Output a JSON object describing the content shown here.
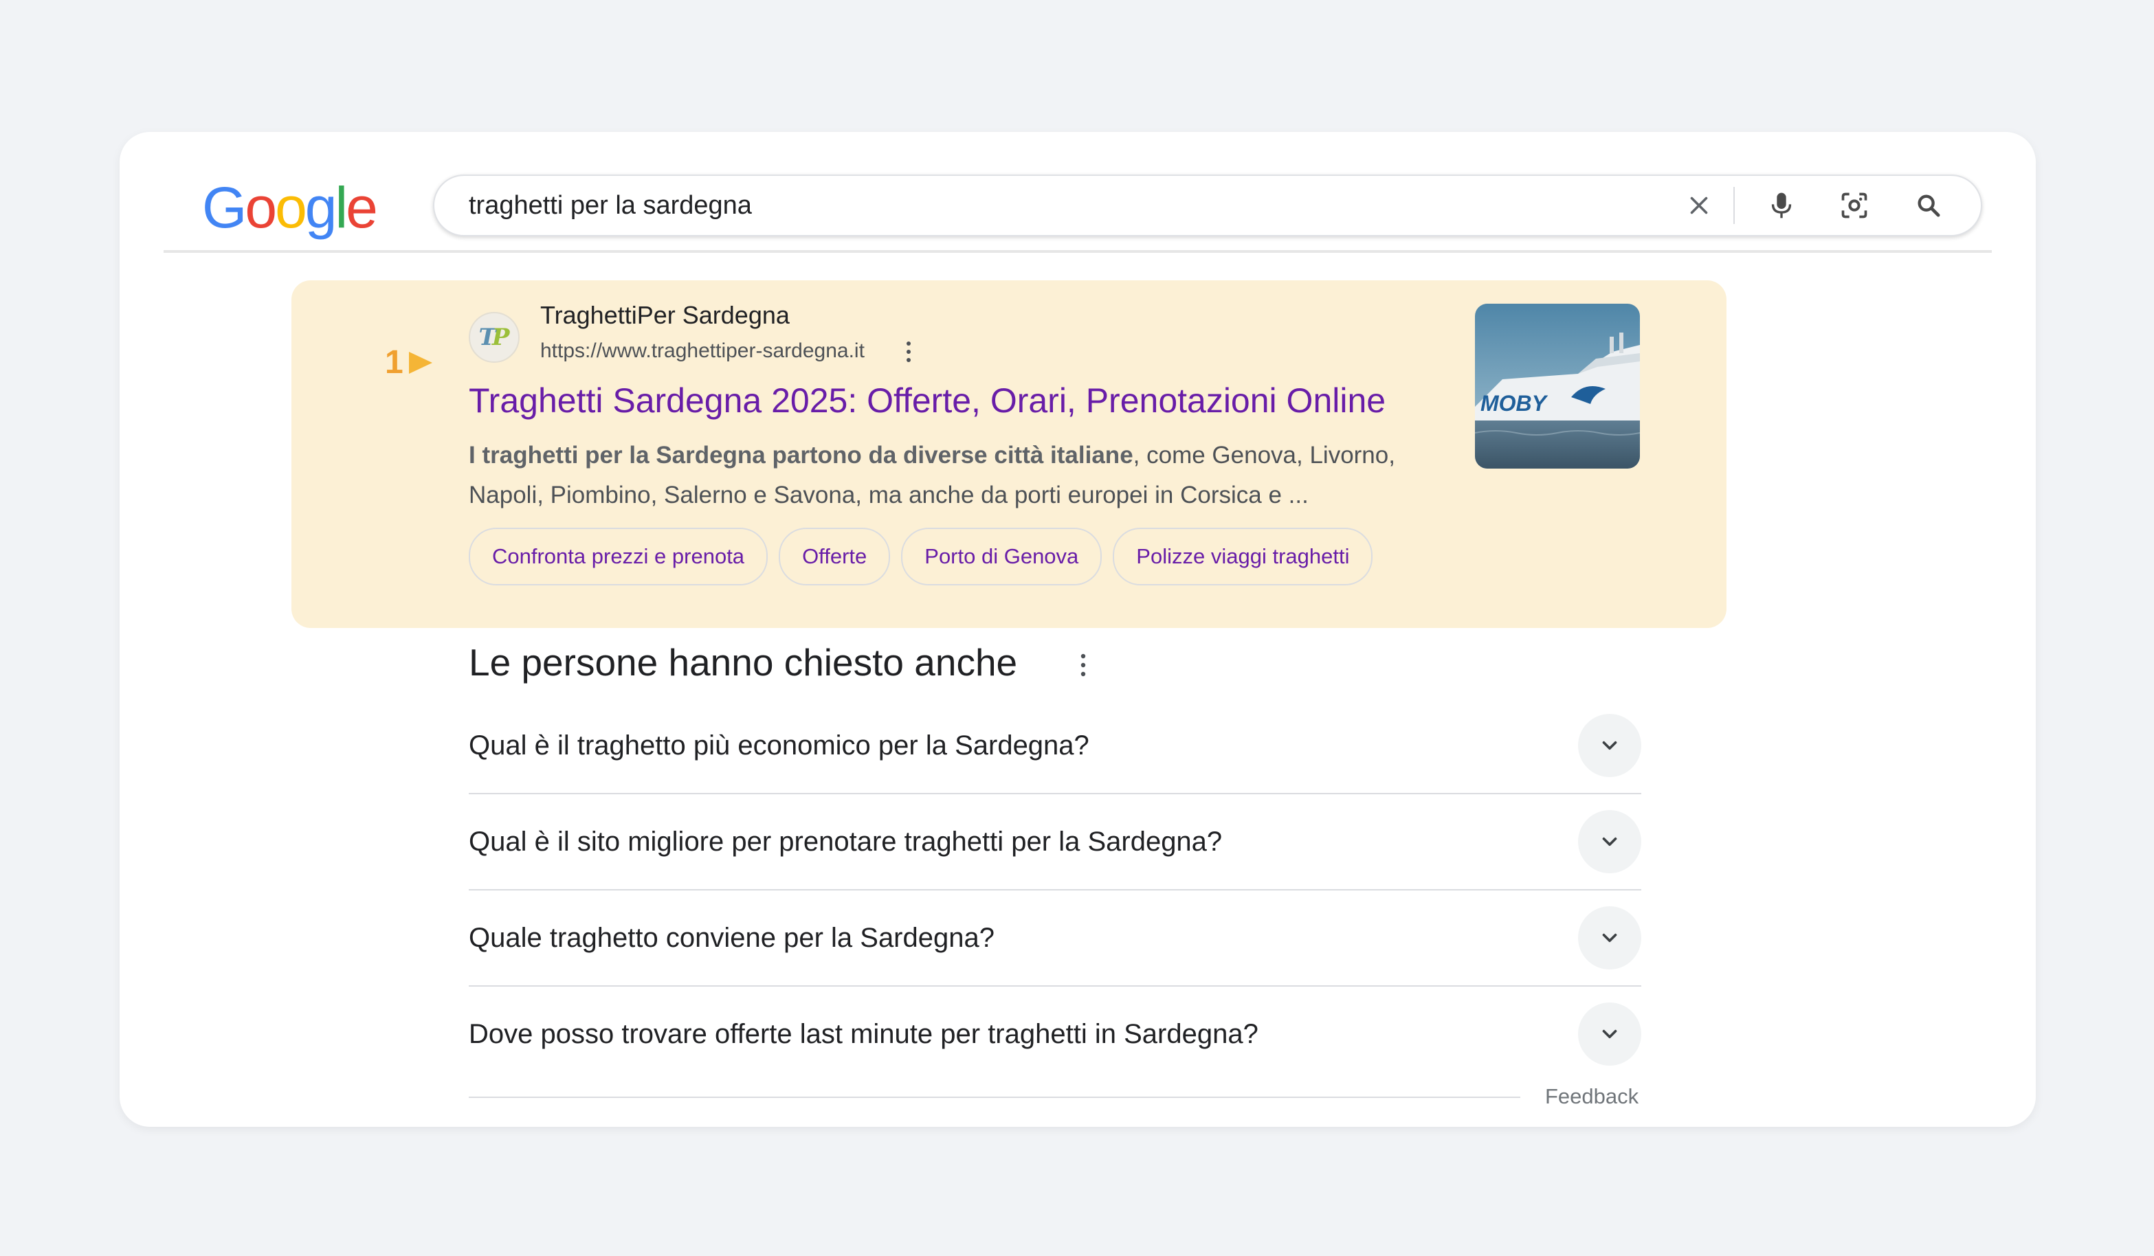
{
  "header": {
    "logo_letters": [
      "G",
      "o",
      "o",
      "g",
      "l",
      "e"
    ],
    "logo_colors": [
      "#4285F4",
      "#EA4335",
      "#FBBC05",
      "#4285F4",
      "#34A853",
      "#EA4335"
    ],
    "search_query": "traghetti per la sardegna",
    "icons": [
      "close-icon",
      "microphone-icon",
      "lens-icon",
      "search-icon"
    ]
  },
  "result": {
    "rank": "1",
    "favicon_letters": [
      "T",
      "P"
    ],
    "site_name": "TraghettiPer Sardegna",
    "url": "https://www.traghettiper-sardegna.it",
    "title": "Traghetti Sardegna 2025: Offerte, Orari, Prenotazioni Online",
    "snippet_bold": "I traghetti per la Sardegna partono da diverse città italiane",
    "snippet_rest": ", come Genova, Livorno, Napoli, Piombino, Salerno e Savona, ma anche da porti europei in Corsica e ...",
    "thumbnail_text": "MOBY",
    "chips": [
      "Confronta prezzi e prenota",
      "Offerte",
      "Porto di Genova",
      "Polizze viaggi traghetti"
    ],
    "highlight_color": "#fcf0d5",
    "title_color": "#681da8"
  },
  "paa": {
    "title": "Le persone hanno chiesto anche",
    "questions": [
      "Qual è il traghetto più economico per la Sardegna?",
      "Qual è il sito migliore per prenotare traghetti per la Sardegna?",
      "Quale traghetto conviene per la Sardegna?",
      "Dove posso trovare offerte last minute per traghetti in Sardegna?"
    ],
    "feedback": "Feedback"
  }
}
